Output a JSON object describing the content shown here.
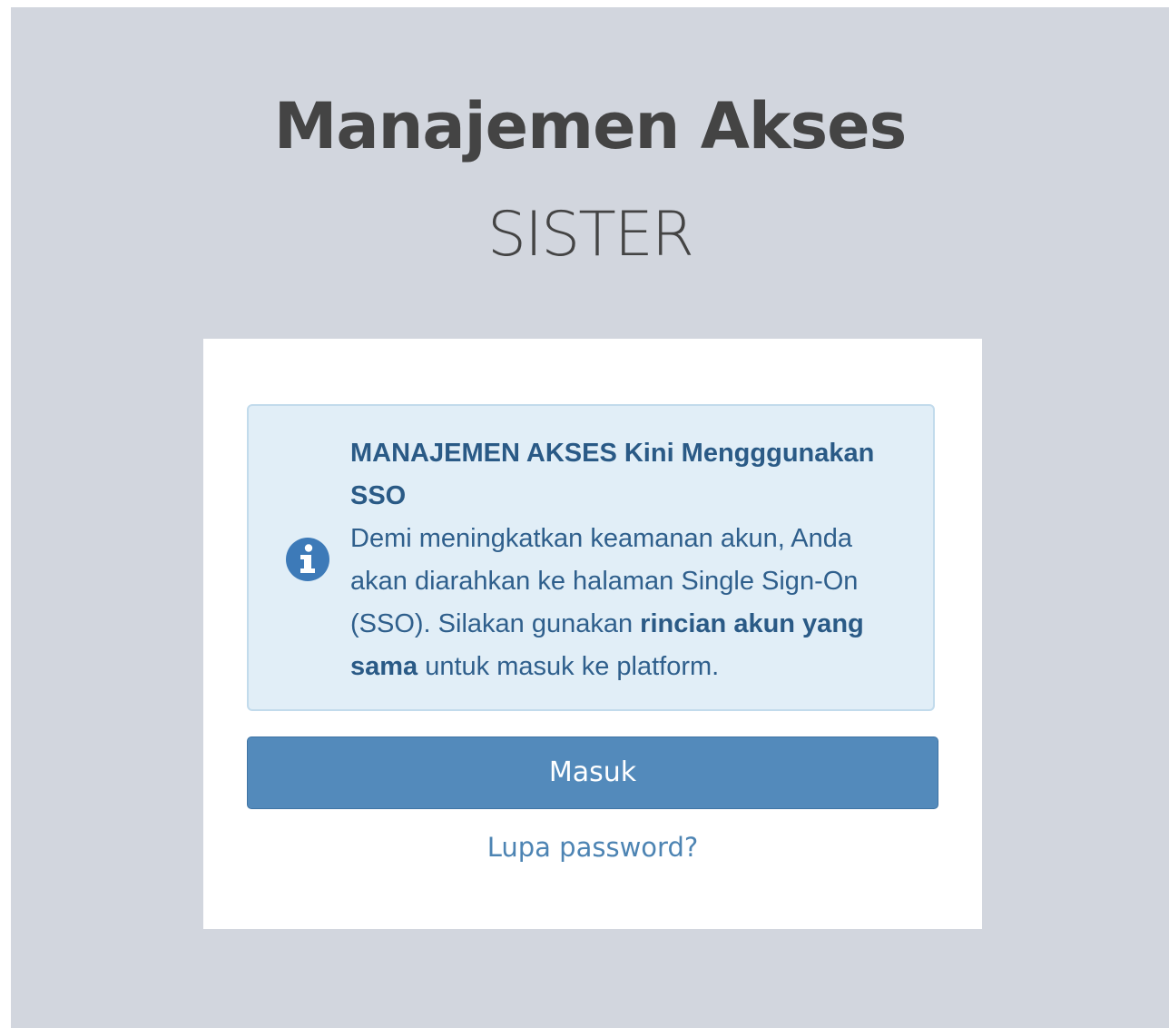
{
  "header": {
    "title": "Manajemen Akses",
    "subtitle": "SISTER"
  },
  "notice": {
    "icon": "info-circle-icon",
    "title": "MANAJEMEN AKSES Kini Mengggunakan SSO",
    "text_part1": "Demi meningkatkan keamanan akun, Anda akan diarahkan ke halaman Single Sign-On (SSO). Silakan gunakan ",
    "text_bold": "rincian akun yang sama",
    "text_part2": " untuk masuk ke platform."
  },
  "login": {
    "button_label": "Masuk",
    "forgot_label": "Lupa password?"
  },
  "colors": {
    "background": "#d2d6de",
    "card": "#ffffff",
    "notice_bg": "#e1eef7",
    "notice_border": "#c2dbec",
    "notice_text": "#2f5f8c",
    "info_icon": "#3d7ab8",
    "button": "#538abb",
    "link": "#4d84b3"
  }
}
